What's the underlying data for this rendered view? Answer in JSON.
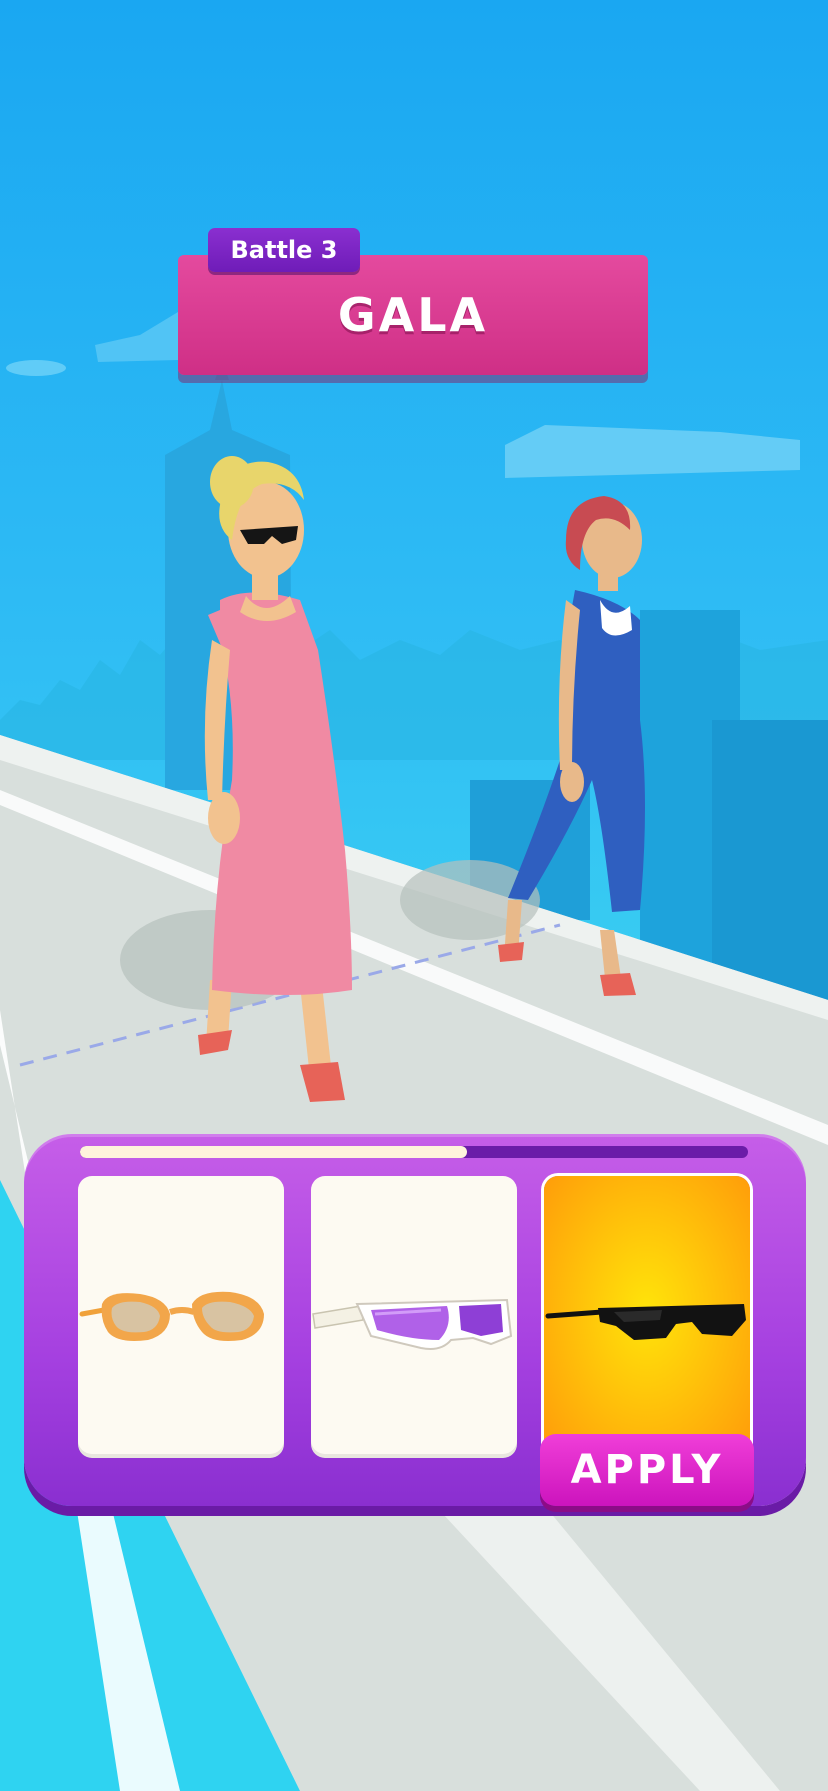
{
  "header": {
    "battle_label": "Battle 3",
    "theme_title": "GALA"
  },
  "selection_panel": {
    "progress": 0.58,
    "items": [
      {
        "icon": "orange-sunglasses-icon",
        "selected": false
      },
      {
        "icon": "white-purple-visor-sunglasses-icon",
        "selected": false
      },
      {
        "icon": "black-slim-sunglasses-icon",
        "selected": true
      }
    ],
    "apply_label": "APPLY"
  },
  "colors": {
    "sky": "#2fbcf4",
    "banner": "#d7378e",
    "battle_tag": "#7a24c4",
    "panel": "#a540e0",
    "apply_button": "#e22ccc",
    "selected_card": "#ffc30a"
  }
}
